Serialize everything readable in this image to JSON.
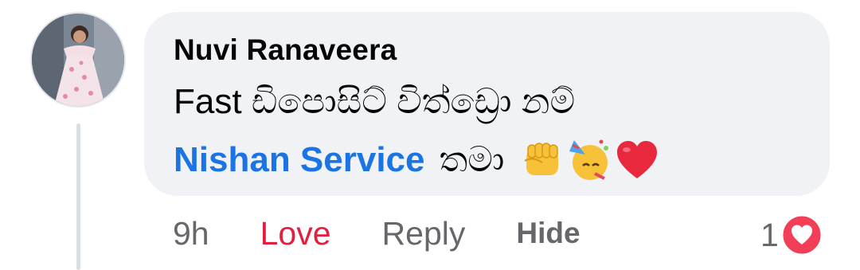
{
  "comment": {
    "author": "Nuvi Ranaveera",
    "text_line1": "Fast ඩිපොසිට් විත්ඩ්‍රො නම්",
    "mention": "Nishan Service",
    "text_tail": "තමා",
    "emojis": [
      "raised-fist-emoji",
      "partying-face-emoji",
      "red-heart-emoji"
    ]
  },
  "actions": {
    "time": "9h",
    "love_label": "Love",
    "reply_label": "Reply",
    "hide_label": "Hide"
  },
  "reactions": {
    "count": "1",
    "icon": "love-reaction-icon"
  },
  "colors": {
    "bubble": "#f0f2f5",
    "mention": "#1b74e4",
    "love": "#e41e3f",
    "muted": "#65676b"
  }
}
